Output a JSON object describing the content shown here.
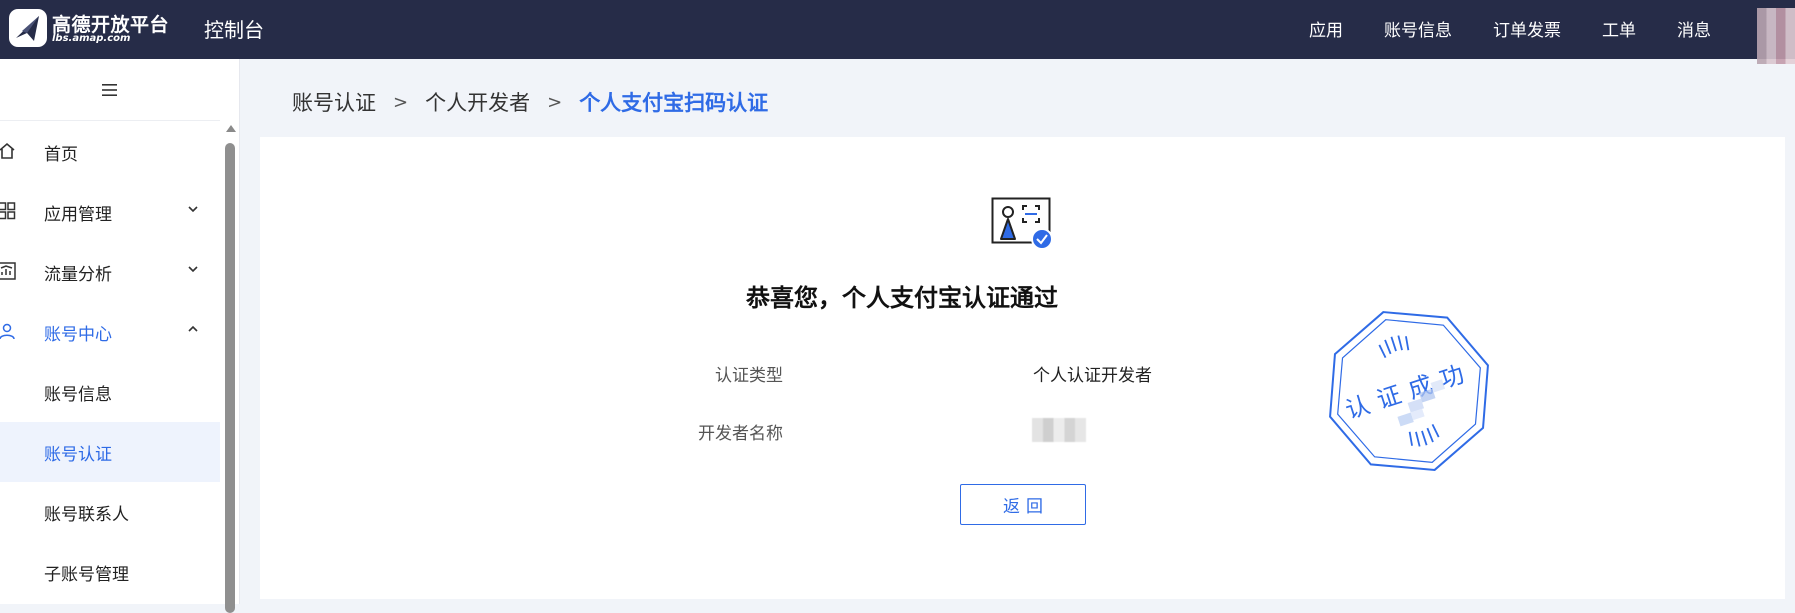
{
  "header": {
    "logo_name": "高德开放平台",
    "logo_url": "lbs.amap.com",
    "console_title": "控制台",
    "nav": [
      "应用",
      "账号信息",
      "订单发票",
      "工单",
      "消息"
    ]
  },
  "sidebar": {
    "items": [
      {
        "label": "首页",
        "icon": "home-icon"
      },
      {
        "label": "应用管理",
        "icon": "grid-icon"
      },
      {
        "label": "流量分析",
        "icon": "chart-icon"
      },
      {
        "label": "账号中心",
        "icon": "user-icon"
      }
    ],
    "sub_items": [
      "账号信息",
      "账号认证",
      "账号联系人",
      "子账号管理"
    ],
    "selected_sub_item": "账号认证"
  },
  "breadcrumb": {
    "items": [
      "账号认证",
      "个人开发者",
      "个人支付宝扫码认证"
    ],
    "separator": ">"
  },
  "result": {
    "title": "恭喜您，个人支付宝认证通过",
    "fields": [
      {
        "label": "认证类型",
        "value": "个人认证开发者"
      },
      {
        "label": "开发者名称",
        "value": ""
      }
    ],
    "back_label": "返回",
    "stamp_text": "认证成功"
  },
  "colors": {
    "accent": "#2f6be6",
    "header_bg": "#262c48",
    "page_bg": "#f1f4f9"
  }
}
